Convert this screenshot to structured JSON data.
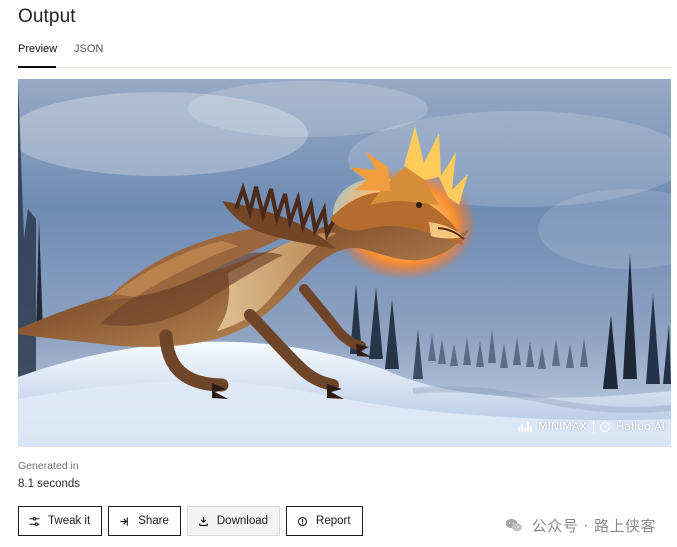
{
  "header": {
    "title": "Output"
  },
  "tabs": [
    {
      "label": "Preview",
      "selected": true
    },
    {
      "label": "JSON",
      "selected": false
    }
  ],
  "preview": {
    "watermark": {
      "brand1": "MINIMAX",
      "brand2": "Hailuo AI"
    }
  },
  "meta": {
    "generated_label": "Generated in",
    "generated_value": "8.1 seconds"
  },
  "actions": [
    {
      "label": "Tweak it",
      "icon": "sliders-icon"
    },
    {
      "label": "Share",
      "icon": "share-icon"
    },
    {
      "label": "Download",
      "icon": "download-icon"
    },
    {
      "label": "Report",
      "icon": "report-icon"
    }
  ],
  "footer": {
    "brand_text": "公众号 · 路上侠客"
  },
  "colors": {
    "primary_text": "#1f1f1f",
    "muted_text": "#6f6f6f",
    "border": "#1c1c1c",
    "tab_divider": "#dfe3d5",
    "download_bg": "#f3f3f3"
  }
}
